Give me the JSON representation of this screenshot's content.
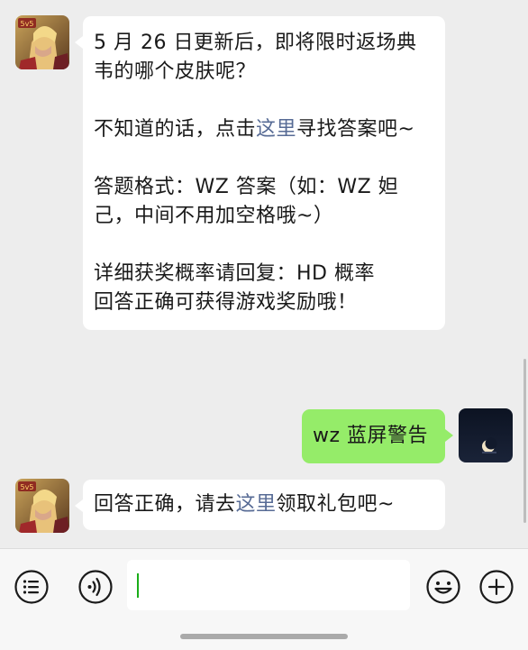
{
  "messages": [
    {
      "side": "incoming",
      "sender_icon": "king-of-glory-avatar",
      "paragraphs": [
        {
          "text": "5 月 26 日更新后，即将限时返场典韦的哪个皮肤呢？"
        },
        {
          "before": "不知道的话，点击",
          "link": "这里",
          "after": "寻找答案吧~"
        },
        {
          "text": "答题格式：WZ 答案（如：WZ 妲己，中间不用加空格哦~）"
        },
        {
          "line1": "详细获奖概率请回复：HD 概率",
          "line2": "回答正确可获得游戏奖励哦！"
        }
      ]
    },
    {
      "side": "outgoing",
      "sender_icon": "night-moon-avatar",
      "text": "wz 蓝屏警告"
    },
    {
      "side": "incoming",
      "sender_icon": "king-of-glory-avatar",
      "before": "回答正确，请去",
      "link": "这里",
      "after": "领取礼包吧~"
    }
  ],
  "avatar_badge": "5v5",
  "input_bar": {
    "value": "",
    "icons": [
      "voice-icon",
      "emoji-icon",
      "plus-icon"
    ]
  },
  "colors": {
    "background": "#ededed",
    "incoming_bubble": "#ffffff",
    "outgoing_bubble": "#95ec69",
    "link": "#576b95",
    "cursor": "#1aad19"
  }
}
